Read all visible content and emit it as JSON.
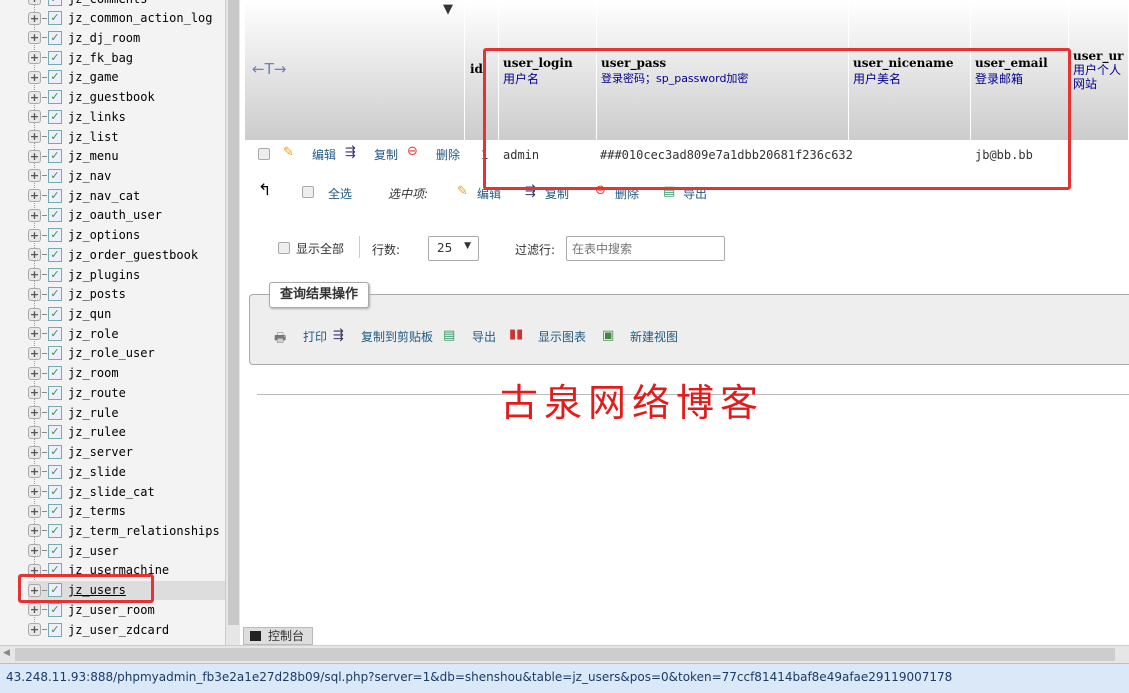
{
  "sidebar": {
    "tables": [
      "jz_comments",
      "jz_common_action_log",
      "jz_dj_room",
      "jz_fk_bag",
      "jz_game",
      "jz_guestbook",
      "jz_links",
      "jz_list",
      "jz_menu",
      "jz_nav",
      "jz_nav_cat",
      "jz_oauth_user",
      "jz_options",
      "jz_order_guestbook",
      "jz_plugins",
      "jz_posts",
      "jz_qun",
      "jz_role",
      "jz_role_user",
      "jz_room",
      "jz_route",
      "jz_rule",
      "jz_rulee",
      "jz_server",
      "jz_slide",
      "jz_slide_cat",
      "jz_terms",
      "jz_term_relationships",
      "jz_user",
      "jz_usermachine",
      "jz_users",
      "jz_user_room",
      "jz_user_zdcard"
    ],
    "active": "jz_users"
  },
  "table": {
    "columns": [
      {
        "name": "id",
        "comment": ""
      },
      {
        "name": "user_login",
        "comment": "用户名"
      },
      {
        "name": "user_pass",
        "comment": "登录密码；sp_password加密"
      },
      {
        "name": "user_nicename",
        "comment": "用户美名"
      },
      {
        "name": "user_email",
        "comment": "登录邮箱"
      },
      {
        "name": "user_ur",
        "comment": "用户个人网站"
      }
    ],
    "row": {
      "edit": "编辑",
      "copy": "复制",
      "delete": "删除",
      "id": "1",
      "user_login": "admin",
      "user_pass": "###010cec3ad809e7a1dbb20681f236c632",
      "user_nicename": "",
      "user_email": "jb@bb.bb"
    },
    "arrows": "←T→"
  },
  "bulk": {
    "check_all": "全选",
    "with_selected": "选中项:",
    "edit": "编辑",
    "copy": "复制",
    "delete": "删除",
    "export": "导出"
  },
  "nav": {
    "show_all": "显示全部",
    "rows_label": "行数:",
    "rows_value": "25",
    "filter_label": "过滤行:",
    "filter_placeholder": "在表中搜索"
  },
  "query_ops": {
    "title": "查询结果操作",
    "print": "打印",
    "copy_clipboard": "复制到剪贴板",
    "export": "导出",
    "chart": "显示图表",
    "create_view": "新建视图"
  },
  "console": "控制台",
  "watermark": "古泉网络博客",
  "status_url": "43.248.11.93:888/phpmyadmin_fb3e2a1e27d28b09/sql.php?server=1&db=shenshou&table=jz_users&pos=0&token=77ccf81414baf8e49afae29119007178",
  "colors": {
    "highlight": "#e53333",
    "link": "#235a81",
    "comment": "#00008b"
  }
}
